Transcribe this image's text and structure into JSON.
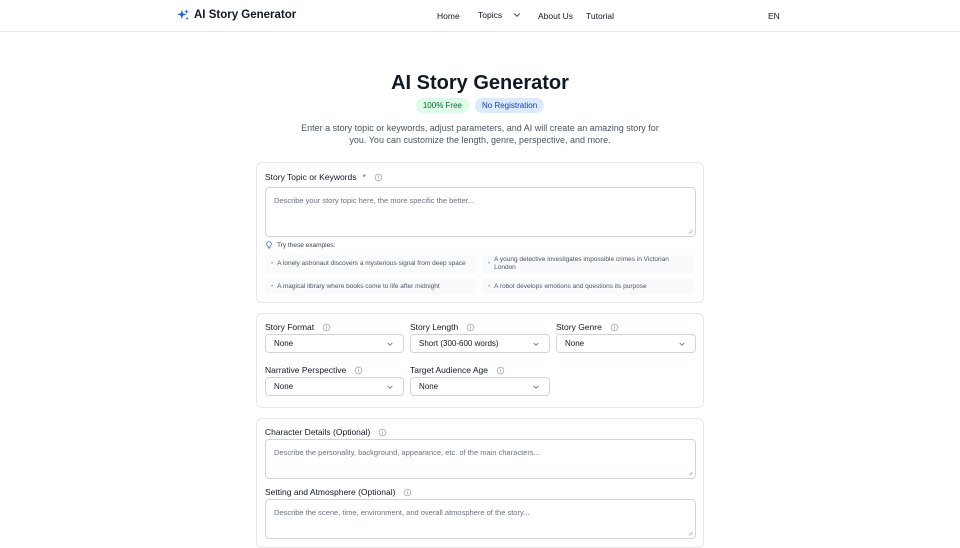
{
  "nav": {
    "brand": "AI Story Generator",
    "links": {
      "home": "Home",
      "topics": "Topics",
      "about": "About Us",
      "tutorial": "Tutorial"
    },
    "lang": "EN",
    "accent": "#2563eb"
  },
  "hero": {
    "title": "AI Story Generator",
    "badge_free": "100% Free",
    "badge_reg": "No Registration",
    "description": "Enter a story topic or keywords, adjust parameters, and AI will create an amazing story for you. You can customize the length, genre, perspective, and more."
  },
  "topic": {
    "label": "Story Topic or Keywords",
    "required": "*",
    "placeholder": "Describe your story topic here, the more specific the better...",
    "examples_head": "Try these examples:",
    "examples": [
      "A lonely astronaut discovers a mysterious signal from deep space",
      "A young detective investigates impossible crimes in Victorian London",
      "A magical library where books come to life after midnight",
      "A robot develops emotions and questions its purpose"
    ]
  },
  "params": {
    "format": {
      "label": "Story Format",
      "value": "None"
    },
    "length": {
      "label": "Story Length",
      "value": "Short (300-600 words)"
    },
    "genre": {
      "label": "Story Genre",
      "value": "None"
    },
    "perspective": {
      "label": "Narrative Perspective",
      "value": "None"
    },
    "audience": {
      "label": "Target Audience Age",
      "value": "None"
    }
  },
  "details": {
    "character_label": "Character Details (Optional)",
    "character_placeholder": "Describe the personality, background, appearance, etc. of the main characters...",
    "setting_label": "Setting and Atmosphere (Optional)",
    "setting_placeholder": "Describe the scene, time, environment, and overall atmosphere of the story..."
  }
}
